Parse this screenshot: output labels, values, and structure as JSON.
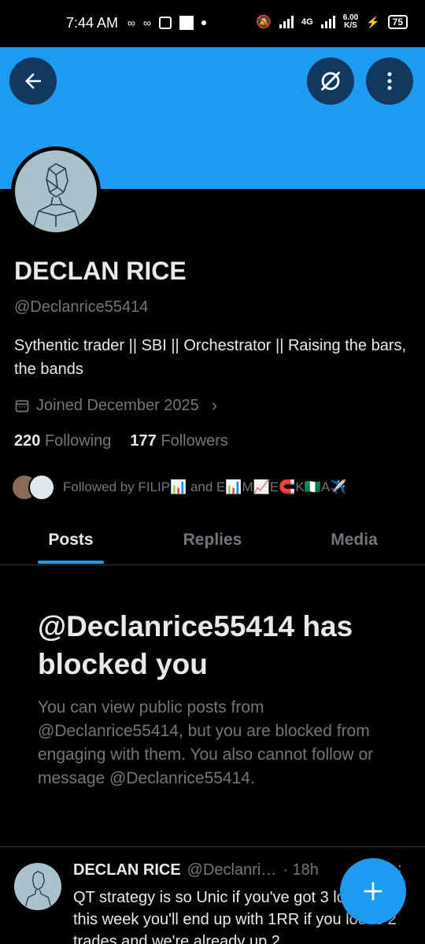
{
  "status_bar": {
    "time": "7:44 AM",
    "network": "4G",
    "speed_value": "6.00",
    "speed_unit": "K/S",
    "battery": "75"
  },
  "header": {
    "back_icon": "arrow-left-icon",
    "grok_icon": "grok-icon",
    "more_icon": "more-vertical-icon",
    "banner_color": "#1d9bf0"
  },
  "profile": {
    "name": "DECLAN RICE",
    "handle": "@Declanrice55414",
    "bio": "Sythentic trader || SBI || Orchestrator || Raising the bars, the bands",
    "joined": "Joined December 2025",
    "following_count": "220",
    "following_label": "Following",
    "followers_count": "177",
    "followers_label": "Followers",
    "followed_by": "Followed by FILIP📊 and E📊M📈E🧲K🇳🇬A✈️"
  },
  "tabs": [
    {
      "label": "Posts",
      "active": true
    },
    {
      "label": "Replies",
      "active": false
    },
    {
      "label": "Media",
      "active": false
    }
  ],
  "blocked": {
    "title": "@Declanrice55414 has blocked you",
    "description": "You can view public posts from @Declanrice55414, but you are blocked from engaging with them. You also cannot follow or message @Declanrice55414."
  },
  "post": {
    "name": "DECLAN RICE",
    "handle": "@Declanri…",
    "time": "· 18h",
    "text": "QT strategy is so Unic if you've got 3 losses this week you'll end up with 1RR if you loose 2 trades and we're already up 2"
  },
  "fab": {
    "icon": "plus-icon",
    "accent": "#1d9bf0"
  }
}
